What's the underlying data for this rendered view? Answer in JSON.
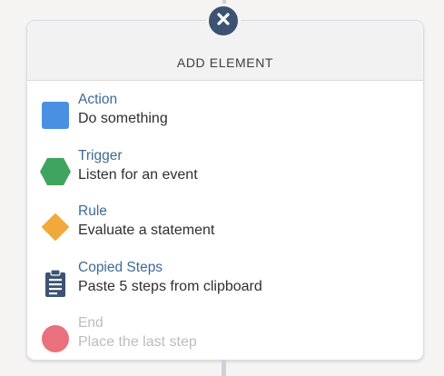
{
  "dialog": {
    "title": "ADD ELEMENT"
  },
  "items": [
    {
      "label": "Action",
      "description": "Do something",
      "icon": "square-icon",
      "color": "#4a90e2"
    },
    {
      "label": "Trigger",
      "description": "Listen for an event",
      "icon": "hexagon-icon",
      "color": "#3fa45e"
    },
    {
      "label": "Rule",
      "description": "Evaluate a statement",
      "icon": "diamond-icon",
      "color": "#f2a93b"
    },
    {
      "label": "Copied Steps",
      "description": "Paste 5 steps from clipboard",
      "icon": "clipboard-icon",
      "color": "#3d5374"
    },
    {
      "label": "End",
      "description": "Place the last step",
      "icon": "circle-icon",
      "color": "#e9707d",
      "disabled": true
    }
  ],
  "colors": {
    "close_button": "#3d5374",
    "label": "#3e6a95",
    "disabled": "#bdbcbb",
    "connector": "#c9d2dc"
  }
}
